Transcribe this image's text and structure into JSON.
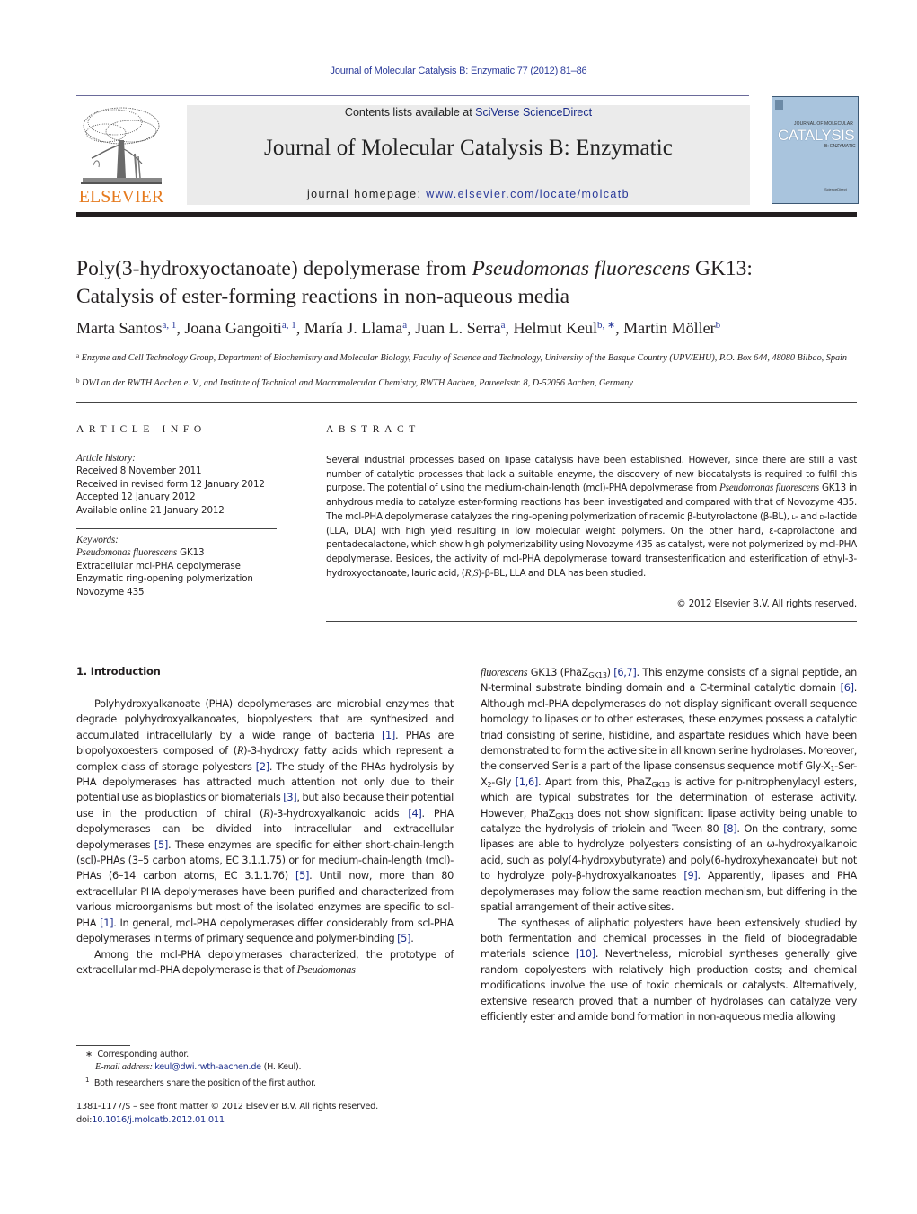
{
  "header": {
    "running_head": "Journal of Molecular Catalysis B: Enzymatic 77 (2012) 81–86",
    "publisher_logo_text": "ELSEVIER",
    "contents_prefix": "Contents lists available at ",
    "contents_link": "SciVerse ScienceDirect",
    "journal_title": "Journal of Molecular Catalysis B: Enzymatic",
    "homepage_prefix": "journal homepage: ",
    "homepage_link": "www.elsevier.com/locate/molcatb",
    "cover": {
      "line1": "JOURNAL OF MOLECULAR",
      "line2": "CATALYSIS",
      "line3": "B: ENZYMATIC",
      "line4": "ScienceDirect"
    },
    "colors": {
      "link_blue": "#2a3a9a",
      "elsevier_orange": "#e57a1e",
      "banner_gray": "#ebebeb",
      "cover_blue": "#a9c4dd"
    }
  },
  "article": {
    "title_part1": "Poly(3-hydroxyoctanoate) depolymerase from ",
    "title_italic": "Pseudomonas fluorescens",
    "title_part2": " GK13:",
    "title_line2": "Catalysis of ester-forming reactions in non-aqueous media",
    "authors": [
      {
        "name": "Marta Santos",
        "sup": "a, 1"
      },
      {
        "name": "Joana Gangoiti",
        "sup": "a, 1"
      },
      {
        "name": "María J. Llama",
        "sup": "a"
      },
      {
        "name": "Juan L. Serra",
        "sup": "a"
      },
      {
        "name": "Helmut Keul",
        "sup": "b, ∗"
      },
      {
        "name": "Martin Möller",
        "sup": "b"
      }
    ],
    "affiliations": [
      {
        "mark": "a",
        "text": "Enzyme and Cell Technology Group, Department of Biochemistry and Molecular Biology, Faculty of Science and Technology, University of the Basque Country (UPV/EHU), P.O. Box 644, 48080 Bilbao, Spain"
      },
      {
        "mark": "b",
        "text": "DWI an der RWTH Aachen e. V., and Institute of Technical and Macromolecular Chemistry, RWTH Aachen, Pauwelsstr. 8, D-52056 Aachen, Germany"
      }
    ]
  },
  "article_info": {
    "heading": "ARTICLE INFO",
    "history_label": "Article history:",
    "history": [
      "Received 8 November 2011",
      "Received in revised form 12 January 2012",
      "Accepted 12 January 2012",
      "Available online 21 January 2012"
    ],
    "keywords_label": "Keywords:",
    "keyword1_italic": "Pseudomonas fluorescens",
    "keyword1_rest": " GK13",
    "keywords": [
      "Extracellular mcl-PHA depolymerase",
      "Enzymatic ring-opening polymerization",
      "Novozyme 435"
    ]
  },
  "abstract": {
    "heading": "ABSTRACT",
    "s1": "Several industrial processes based on lipase catalysis have been established. However, since there are still a vast number of catalytic processes that lack a suitable enzyme, the discovery of new biocatalysts is required to fulfil this purpose. The potential of using the medium-chain-length (mcl)-PHA depolymerase from ",
    "s1_italic": "Pseudomonas fluorescens",
    "s2": " GK13 in anhydrous media to catalyze ester-forming reactions has been investigated and compared with that of Novozyme 435. The mcl-PHA depolymerase catalyzes the ring-opening polymerization of racemic β-butyrolactone (β-BL), ",
    "sc_l": "l",
    "s3": "- and ",
    "sc_d": "d",
    "s4": "-lactide (LLA, DLA) with high yield resulting in low molecular weight polymers. On the other hand, ε-caprolactone and pentadecalactone, which show high polymerizability using Novozyme 435 as catalyst, were not polymerized by mcl-PHA depolymerase. Besides, the activity of mcl-PHA depolymerase toward transesterification and esterification of ethyl-3-hydroxyoctanoate, lauric acid, (",
    "s4_italic": "R,S",
    "s5": ")-β-BL, LLA and DLA has been studied.",
    "copyright": "© 2012 Elsevier B.V. All rights reserved."
  },
  "introduction": {
    "heading": "1.  Introduction",
    "left": {
      "p1_a": "Polyhydroxyalkanoate (PHA) depolymerases are microbial enzymes that degrade polyhydroxyalkanoates, biopolyesters that are synthesized and accumulated intracellularly by a wide range of bacteria ",
      "ref1": "[1]",
      "p1_b": ". PHAs are biopolyoxoesters composed of (",
      "p1_r": "R",
      "p1_c": ")-3-hydroxy fatty acids which represent a complex class of storage polyesters ",
      "ref2": "[2]",
      "p1_d": ". The study of the PHAs hydrolysis by PHA depolymerases has attracted much attention not only due to their potential use as bioplastics or biomaterials ",
      "ref3": "[3]",
      "p1_e": ", but also because their potential use in the production of chiral (",
      "p1_r2": "R",
      "p1_f": ")-3-hydroxyalkanoic acids ",
      "ref4": "[4]",
      "p1_g": ". PHA depolymerases can be divided into intracellular and extracellular depolymerases ",
      "ref5": "[5]",
      "p1_h": ". These enzymes are specific for either short-chain-length (scl)-PHAs (3–5 carbon atoms, EC 3.1.1.75) or for medium-chain-length (mcl)-PHAs (6–14 carbon atoms, EC 3.1.1.76) ",
      "ref5b": "[5]",
      "p1_i": ". Until now, more than 80 extracellular PHA depolymerases have been purified and characterized from various microorganisms but most of the isolated enzymes are specific to scl-PHA ",
      "ref1b": "[1]",
      "p1_j": ". In general, mcl-PHA depolymerases differ considerably from scl-PHA depolymerases in terms of primary sequence and polymer-binding ",
      "ref5c": "[5]",
      "p1_k": ".",
      "p2_a": "Among the mcl-PHA depolymerases characterized, the prototype of extracellular mcl-PHA depolymerase is that of ",
      "p2_it": "Pseudomonas"
    },
    "right": {
      "c_it": "fluorescens",
      "c_a": " GK13 (PhaZ",
      "sub_gk13": "GK13",
      "c_b": ") ",
      "ref67": "[6,7]",
      "c_c": ". This enzyme consists of a signal peptide, an N-terminal substrate binding domain and a C-terminal catalytic domain ",
      "ref6": "[6]",
      "c_d": ". Although mcl-PHA depolymerases do not display significant overall sequence homology to lipases or to other esterases, these enzymes possess a catalytic triad consisting of serine, histidine, and aspartate residues which have been demonstrated to form the active site in all known serine hydrolases. Moreover, the conserved Ser is a part of the lipase consensus sequence motif Gly-X",
      "sub1": "1",
      "c_e": "-Ser-X",
      "sub2": "2",
      "c_f": "-Gly ",
      "ref16": "[1,6]",
      "c_g": ". Apart from this, PhaZ",
      "c_h": " is active for p-nitrophenylacyl esters, which are typical substrates for the determination of esterase activity. However, PhaZ",
      "c_i": " does not show significant lipase activity being unable to catalyze the hydrolysis of triolein and Tween 80 ",
      "ref8": "[8]",
      "c_j": ". On the contrary, some lipases are able to hydrolyze polyesters consisting of an ω-hydroxyalkanoic acid, such as poly(4-hydroxybutyrate) and poly(6-hydroxyhexanoate) but not to hydrolyze poly-β-hydroxyalkanoates ",
      "ref9": "[9]",
      "c_k": ". Apparently, lipases and PHA depolymerases may follow the same reaction mechanism, but differing in the spatial arrangement of their active sites.",
      "p2_a": "The syntheses of aliphatic polyesters have been extensively studied by both fermentation and chemical processes in the field of biodegradable materials science ",
      "ref10": "[10]",
      "p2_b": ". Nevertheless, microbial syntheses generally give random copolyesters with relatively high production costs; and chemical modifications involve the use of toxic chemicals or catalysts. Alternatively, extensive research proved that a number of hydrolases can catalyze very efficiently ester and amide bond formation in non-aqueous media allowing"
    }
  },
  "footnotes": {
    "star_mark": "∗",
    "corresponding": "Corresponding author.",
    "email_label": "E-mail address: ",
    "email": "keul@dwi.rwth-aachen.de",
    "email_suffix": " (H. Keul).",
    "one_mark": "1",
    "shared": "Both researchers share the position of the first author."
  },
  "front_matter": {
    "issn_line": "1381-1177/$ – see front matter © 2012 Elsevier B.V. All rights reserved.",
    "doi_prefix": "doi:",
    "doi": "10.1016/j.molcatb.2012.01.011"
  }
}
